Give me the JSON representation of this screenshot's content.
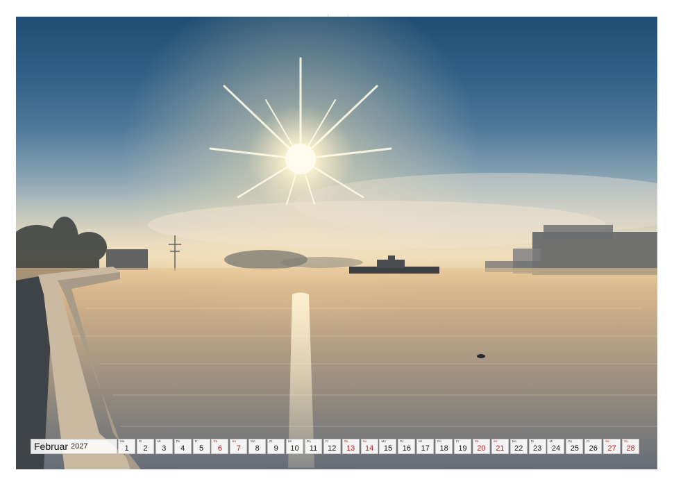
{
  "calendar": {
    "month": "Februar",
    "year": "2027",
    "days": [
      {
        "wd": "Mo",
        "n": "1",
        "weekend": false
      },
      {
        "wd": "Di",
        "n": "2",
        "weekend": false
      },
      {
        "wd": "Mi",
        "n": "3",
        "weekend": false
      },
      {
        "wd": "Do",
        "n": "4",
        "weekend": false
      },
      {
        "wd": "Fr",
        "n": "5",
        "weekend": false
      },
      {
        "wd": "Sa",
        "n": "6",
        "weekend": true
      },
      {
        "wd": "So",
        "n": "7",
        "weekend": true
      },
      {
        "wd": "Mo",
        "n": "8",
        "weekend": false
      },
      {
        "wd": "Di",
        "n": "9",
        "weekend": false
      },
      {
        "wd": "Mi",
        "n": "10",
        "weekend": false
      },
      {
        "wd": "Do",
        "n": "11",
        "weekend": false
      },
      {
        "wd": "Fr",
        "n": "12",
        "weekend": false
      },
      {
        "wd": "Sa",
        "n": "13",
        "weekend": true
      },
      {
        "wd": "So",
        "n": "14",
        "weekend": true
      },
      {
        "wd": "Mo",
        "n": "15",
        "weekend": false
      },
      {
        "wd": "Di",
        "n": "16",
        "weekend": false
      },
      {
        "wd": "Mi",
        "n": "17",
        "weekend": false
      },
      {
        "wd": "Do",
        "n": "18",
        "weekend": false
      },
      {
        "wd": "Fr",
        "n": "19",
        "weekend": false
      },
      {
        "wd": "Sa",
        "n": "20",
        "weekend": true
      },
      {
        "wd": "So",
        "n": "21",
        "weekend": true
      },
      {
        "wd": "Mo",
        "n": "22",
        "weekend": false
      },
      {
        "wd": "Di",
        "n": "23",
        "weekend": false
      },
      {
        "wd": "Mi",
        "n": "24",
        "weekend": false
      },
      {
        "wd": "Do",
        "n": "25",
        "weekend": false
      },
      {
        "wd": "Fr",
        "n": "26",
        "weekend": false
      },
      {
        "wd": "Sa",
        "n": "27",
        "weekend": true
      },
      {
        "wd": "So",
        "n": "28",
        "weekend": true
      }
    ]
  },
  "colors": {
    "weekend": "#c0161b",
    "sun": "#fff6d8",
    "sky_top": "#1f4d73"
  },
  "photo": {
    "subject-icons": [
      "sun-icon",
      "ferry-icon",
      "duck-icon",
      "quay-wall-icon",
      "tower-icon"
    ]
  }
}
